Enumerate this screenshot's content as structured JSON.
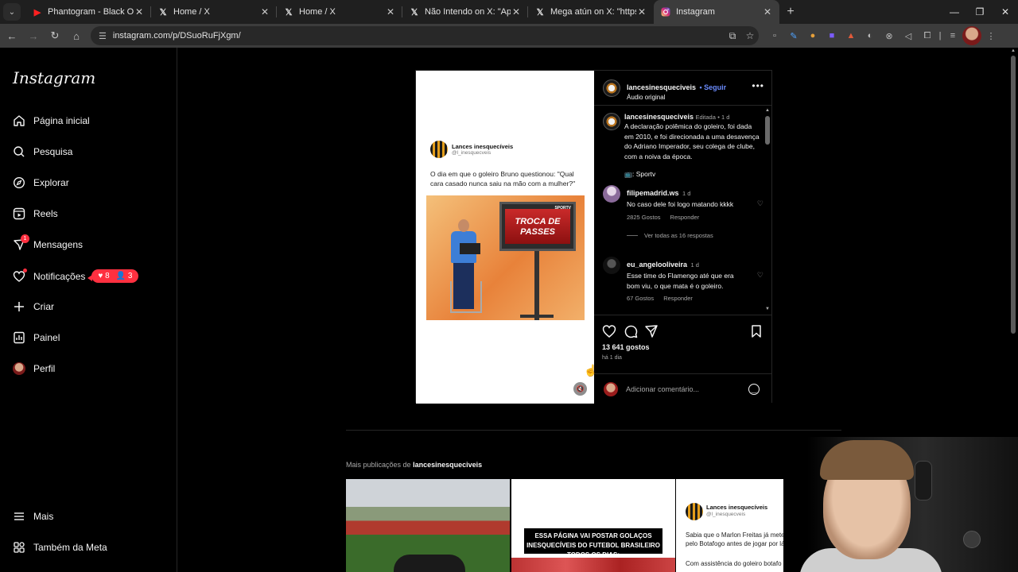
{
  "browser": {
    "tabs": [
      {
        "title": "Phantogram - Black Out Days (",
        "icon": "youtube-icon"
      },
      {
        "title": "Home / X",
        "icon": "x-icon"
      },
      {
        "title": "Home / X",
        "icon": "x-icon"
      },
      {
        "title": "Não Intendo on X: \"Aprendam",
        "icon": "x-icon"
      },
      {
        "title": "Mega atún on X: \"https://t.co/X",
        "icon": "x-icon"
      },
      {
        "title": "Instagram",
        "icon": "instagram-icon",
        "active": true
      }
    ],
    "url": "instagram.com/p/DSuoRuFjXgm/"
  },
  "sidebar": {
    "logo": "Instagram",
    "items": [
      {
        "label": "Página inicial",
        "icon": "home-icon"
      },
      {
        "label": "Pesquisa",
        "icon": "search-icon"
      },
      {
        "label": "Explorar",
        "icon": "compass-icon"
      },
      {
        "label": "Reels",
        "icon": "reels-icon"
      },
      {
        "label": "Mensagens",
        "icon": "messenger-icon",
        "badge": "1"
      },
      {
        "label": "Notificações",
        "icon": "heart-icon"
      },
      {
        "label": "Criar",
        "icon": "plus-icon"
      },
      {
        "label": "Painel",
        "icon": "dashboard-icon"
      },
      {
        "label": "Perfil",
        "icon": "avatar"
      }
    ],
    "notifications_pill": {
      "likes": "8",
      "follows": "3"
    },
    "more": "Mais",
    "meta": "Também da Meta"
  },
  "post": {
    "media": {
      "tweet_name": "Lances inesquecíveis",
      "tweet_handle": "@l_inesquecveis",
      "tweet_text": "O dia em que o goleiro Bruno questionou: \"Qual cara casado nunca saiu na mão com a mulher?\"",
      "tv_text": "TROCA DE PASSES",
      "tv_logo": "SPORTV"
    },
    "header": {
      "username": "lancesinesqueciveis",
      "follow": "• Seguir",
      "audio": "Áudio original"
    },
    "caption": {
      "username": "lancesinesqueciveis",
      "edited": "Editada",
      "time": "• 1 d",
      "text": "A declaração polêmica do goleiro, foi dada em 2010, e foi direcionada a uma desavença do Adriano Imperador, seu colega de clube, com a noiva da época.",
      "source": ": Sportv"
    },
    "comments": [
      {
        "username": "filipemadrid.ws",
        "time": "1 d",
        "text": "No caso dele foi logo matando kkkk",
        "likes": "2825 Gostos",
        "reply": "Responder",
        "view_replies": "Ver todas as 16 respostas"
      },
      {
        "username": "eu_angelooliveira",
        "time": "1 d",
        "text": "Esse time do Flamengo até que era bom viu, o que mata é o goleiro.",
        "likes": "67 Gostos",
        "reply": "Responder"
      }
    ],
    "likes": "13 641 gostos",
    "ago": "há 1 dia",
    "comment_placeholder": "Adicionar comentário..."
  },
  "more_posts": {
    "prefix": "Mais publicações de",
    "username": "lancesinesqueciveis",
    "grid2_banner": "ESSA PÁGINA VAI POSTAR GOLAÇOS INESQUECÍVEIS DO FUTEBOL BRASILEIRO TODOS OS DIAS:",
    "grid3_name": "Lances inesquecíveis",
    "grid3_handle": "@l_inesquecveis",
    "grid3_text": "Sabia que o Marlon Freitas já meteu gol pelo Botafogo antes de jogar por lá?",
    "grid3_text2": "Com assistência do goleiro botafo"
  },
  "colors": {
    "accent": "#0095f6",
    "follow": "#6b8cff",
    "notification": "#ff3040"
  }
}
